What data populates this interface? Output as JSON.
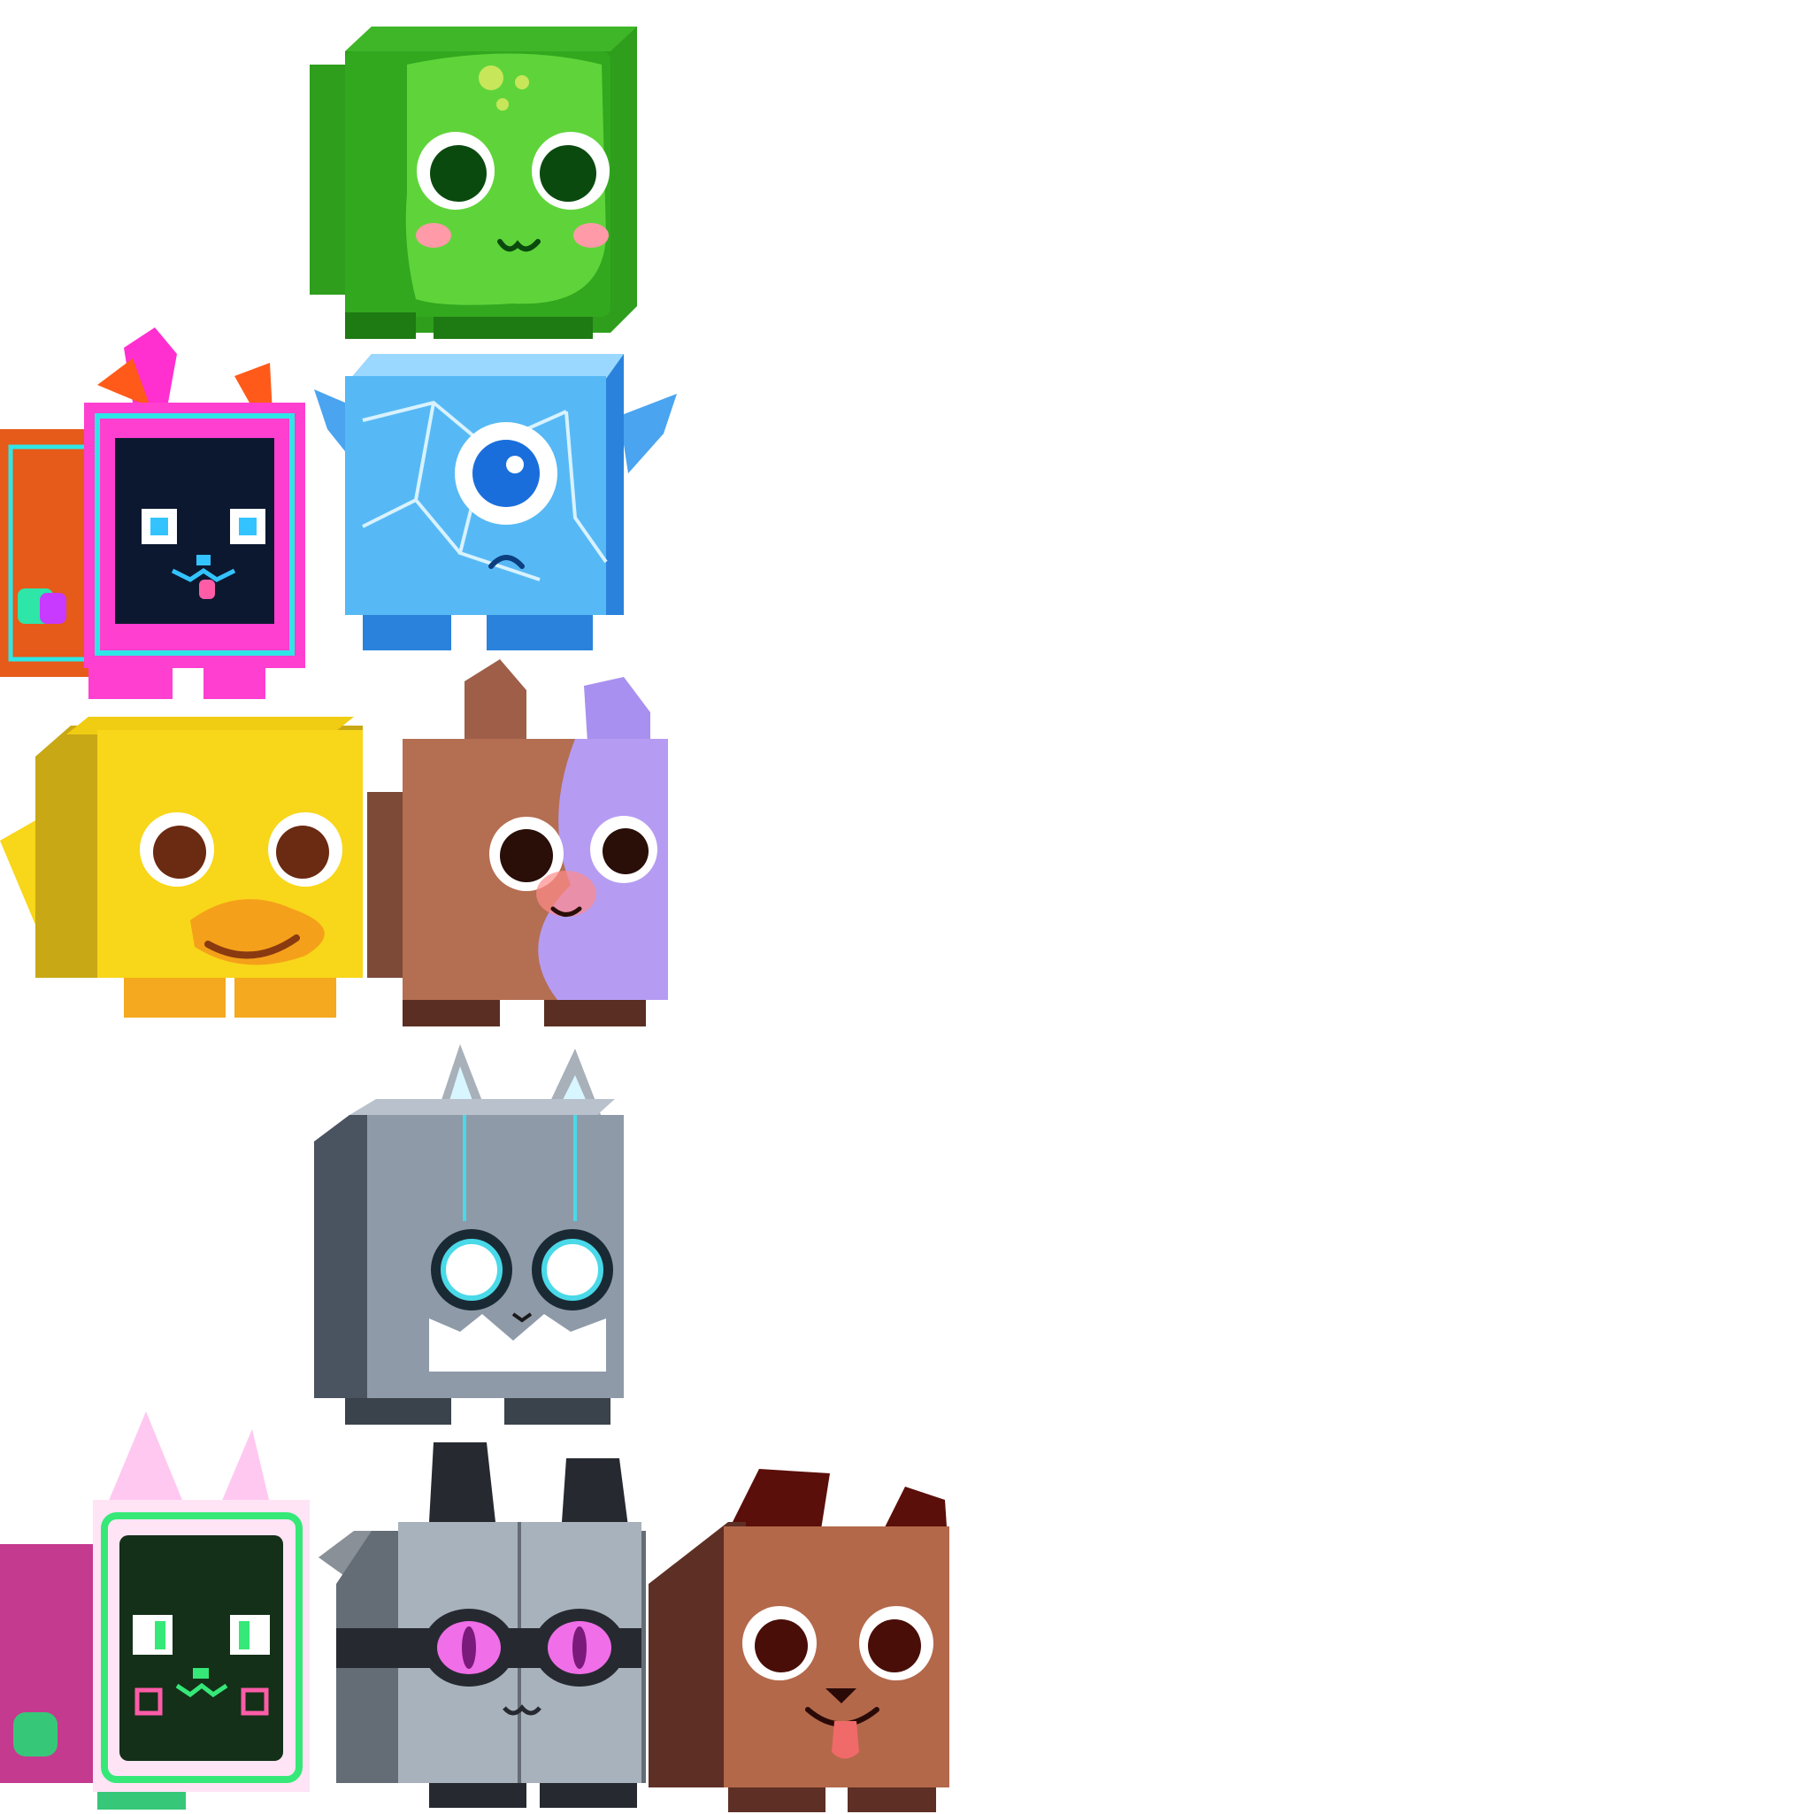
{
  "pets": [
    {
      "name": "slime",
      "colors": {
        "front": "#5fd43a",
        "side": "#2e9e1c",
        "top": "#3fb628",
        "eye": "#0b4a0f",
        "blush": "#ff9aa8",
        "spot": "#c8e65a"
      }
    },
    {
      "name": "pixel-cat",
      "colors": {
        "front": "#ff3fd0",
        "side": "#e65a1a",
        "screen": "#0c1830",
        "accent": "#2ee6e6",
        "eye": "#33c4ff",
        "tongue": "#ff5ca8"
      }
    },
    {
      "name": "ice-cyclops",
      "colors": {
        "front": "#56b9f5",
        "side": "#2a82dc",
        "top": "#9ad8ff",
        "eye": "#1a6edc",
        "crack": "#d8f2ff"
      }
    },
    {
      "name": "duck",
      "colors": {
        "front": "#f8d619",
        "side": "#c8a814",
        "beak": "#f5a01a",
        "eye": "#6b2a12",
        "feet": "#f5a91f"
      }
    },
    {
      "name": "split-bear",
      "colors": {
        "front": "#b46e52",
        "side": "#7e4a38",
        "galaxy": "#b59cf2",
        "eye": "#2a0e08",
        "blush": "#ff8a8a"
      }
    },
    {
      "name": "robot-wolf",
      "colors": {
        "front": "#8f9aa8",
        "side": "#4a5360",
        "top": "#b9c2cc",
        "eye": "#49d9e8",
        "fur": "#ffffff"
      }
    },
    {
      "name": "arcade-cat",
      "colors": {
        "front": "#ff7ccf",
        "side": "#c43a8e",
        "screen": "#143018",
        "accent": "#36e878",
        "ear": "#ffc8f0"
      }
    },
    {
      "name": "robot-raccoon",
      "colors": {
        "front": "#a8b2bc",
        "side": "#646c76",
        "mask": "#262a30",
        "eye": "#f06ee8",
        "ear": "#262a30"
      }
    },
    {
      "name": "dog",
      "colors": {
        "front": "#b3684a",
        "side": "#5e2f24",
        "ear": "#5a0f0a",
        "eye": "#4a0e08",
        "tongue": "#f06a6a"
      }
    }
  ]
}
